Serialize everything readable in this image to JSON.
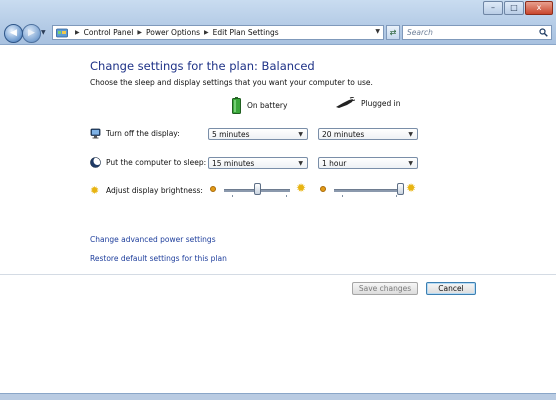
{
  "window": {
    "minimize_glyph": "–",
    "maximize_glyph": "□",
    "close_glyph": "x"
  },
  "address_bar": {
    "crumbs": [
      "Control Panel",
      "Power Options",
      "Edit Plan Settings"
    ],
    "search_placeholder": "Search"
  },
  "page": {
    "title": "Change settings for the plan: Balanced",
    "subtitle": "Choose the sleep and display settings that you want your computer to use."
  },
  "columns": {
    "on_battery": "On battery",
    "plugged_in": "Plugged in"
  },
  "settings": {
    "display": {
      "label": "Turn off the display:",
      "battery_value": "5 minutes",
      "plugged_value": "20 minutes"
    },
    "sleep": {
      "label": "Put the computer to sleep:",
      "battery_value": "15 minutes",
      "plugged_value": "1 hour"
    },
    "brightness": {
      "label": "Adjust display brightness:",
      "battery_level": 0.5,
      "plugged_level": 1.0
    }
  },
  "links": {
    "advanced": "Change advanced power settings",
    "restore": "Restore default settings for this plan"
  },
  "buttons": {
    "save": "Save changes",
    "cancel": "Cancel"
  },
  "colors": {
    "title": "#1e3287",
    "link": "#1e3e9c",
    "battery_green": "#3aa63a"
  }
}
